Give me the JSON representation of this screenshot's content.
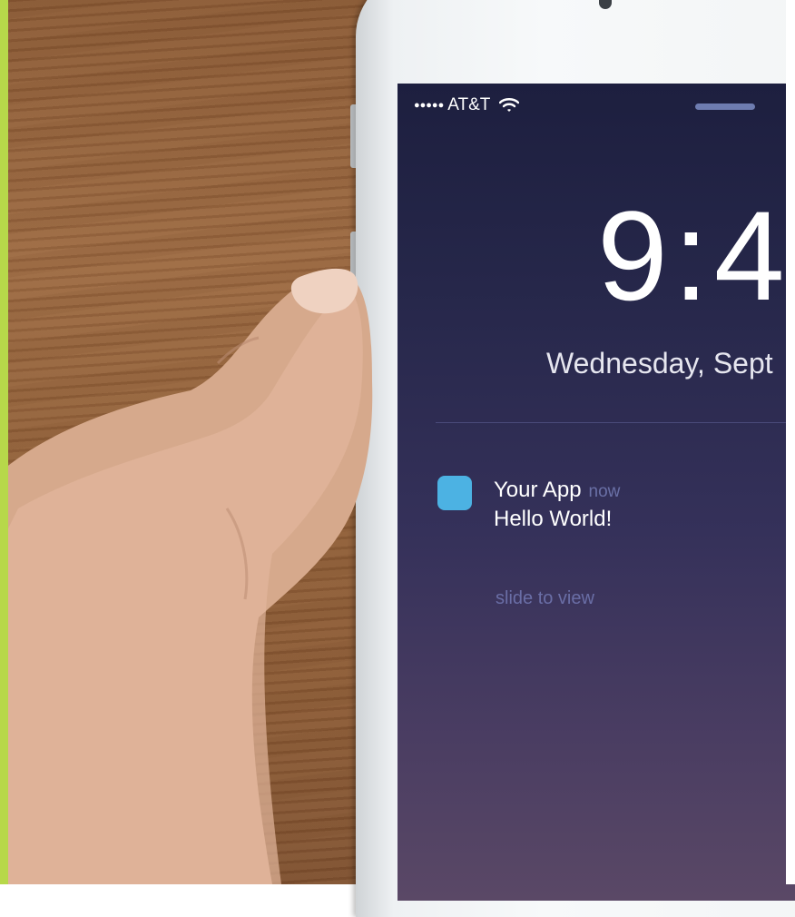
{
  "status_bar": {
    "signal": "●●●●●",
    "carrier": "AT&T"
  },
  "lock_screen": {
    "time": "9:4",
    "date": "Wednesday, Sept"
  },
  "notification": {
    "app_name": "Your App",
    "time": "now",
    "message": "Hello World!",
    "icon_color": "#4cb2e3"
  },
  "slide_hint": "slide to view",
  "colors": {
    "accent_bar": "#b7d84a",
    "screen_top": "#1d1f3f",
    "screen_bottom": "#5a4866"
  }
}
